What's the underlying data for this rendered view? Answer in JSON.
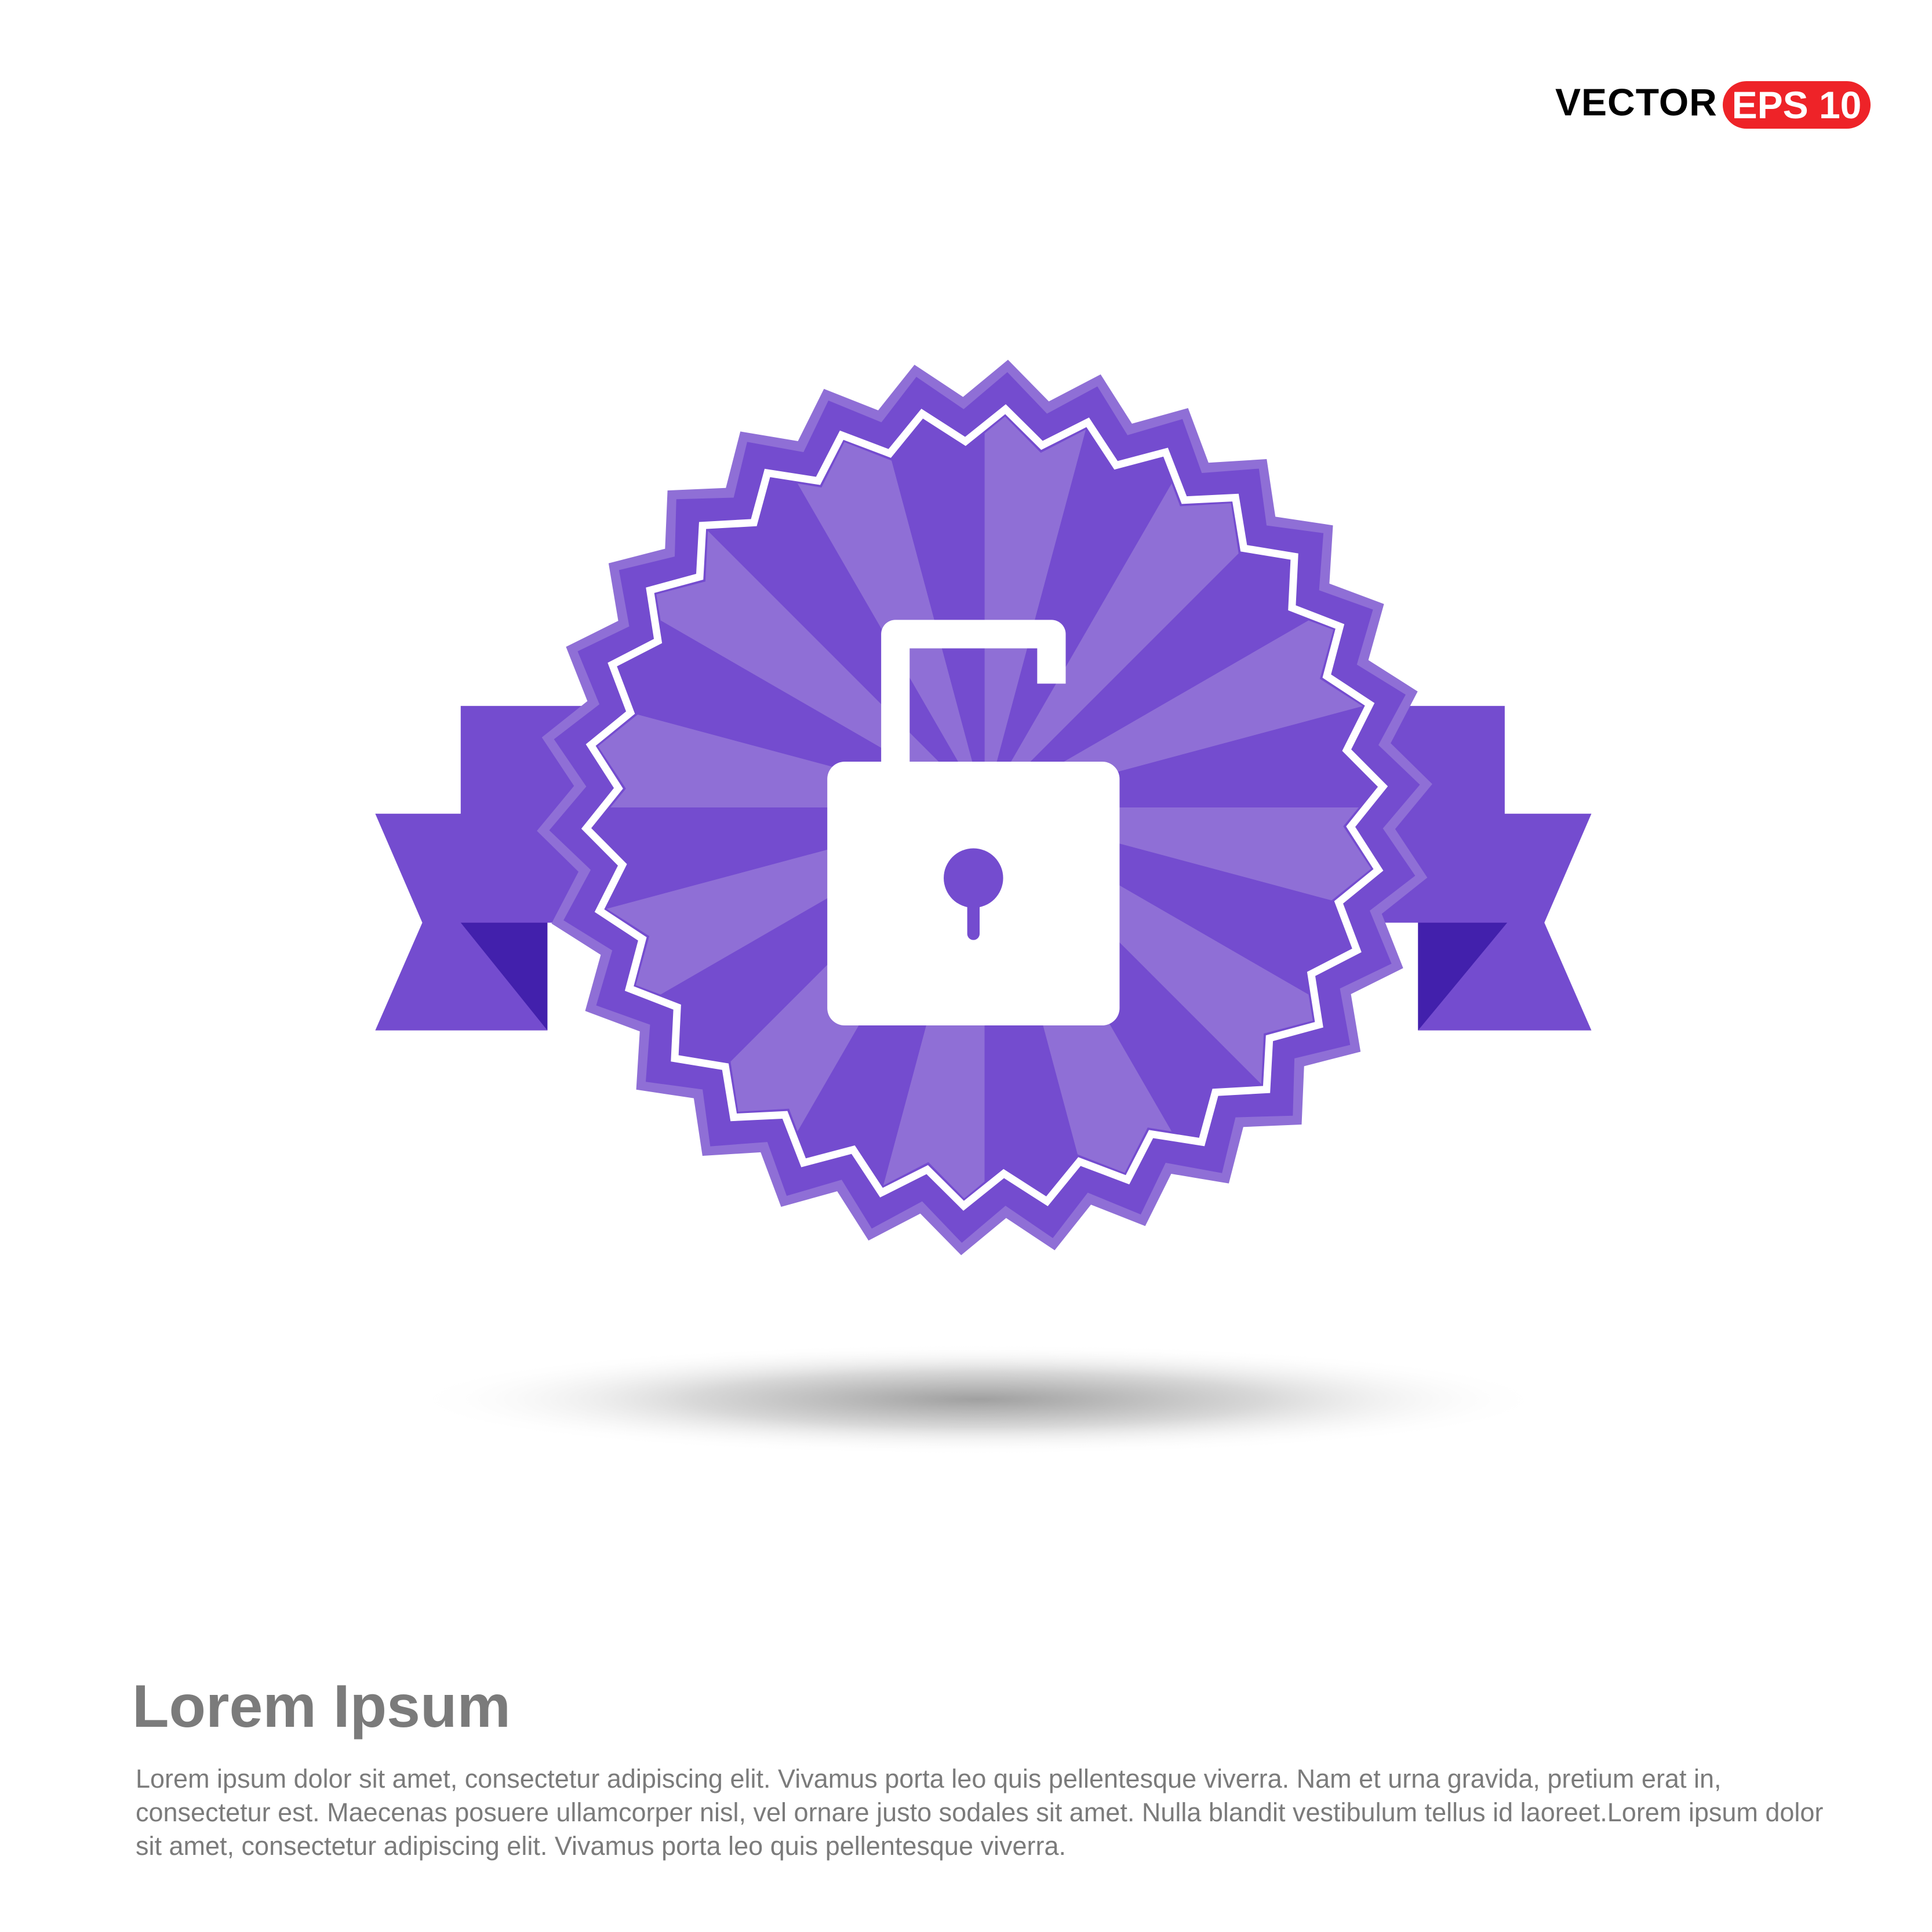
{
  "badge": {
    "vector_label": "VECTOR",
    "eps_label": "EPS 10"
  },
  "colors": {
    "purple_dark": "#744ccf",
    "purple_light": "#8f6fd6",
    "purple_deep": "#4220ac",
    "eps_red": "#ee2328",
    "text_gray": "#7b7b7b"
  },
  "icon": "unlocked-padlock-icon",
  "footer": {
    "title": "Lorem Ipsum",
    "body": "Lorem ipsum dolor sit amet, consectetur adipiscing elit. Vivamus porta leo quis pellentesque viverra. Nam et urna gravida, pretium erat in, consectetur est. Maecenas posuere ullamcorper nisl, vel ornare justo sodales sit amet. Nulla blandit vestibulum tellus id laoreet.Lorem ipsum dolor sit amet, consectetur adipiscing elit. Vivamus porta leo quis pellentesque viverra."
  }
}
